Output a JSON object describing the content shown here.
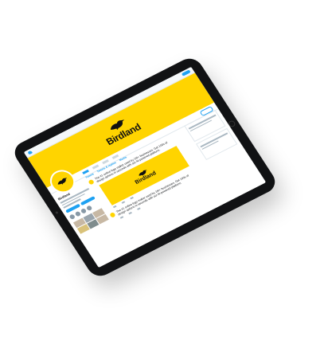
{
  "brand": {
    "name": "Birdland"
  },
  "profile": {
    "name": "Birdland"
  },
  "timeline": {
    "tabs": [
      "Tweets",
      "Tweets & replies",
      "Media"
    ]
  },
  "tweets": [
    {
      "text": "The #1 online logo maker used by 1M+ businesses. Get 100s of design options in seconds with our AI-powered platform.",
      "card_label": "Birdland"
    },
    {
      "text": "The #1 online logo maker used by 1M+ businesses. Get 100s of design options in seconds with our AI-powered platform."
    }
  ],
  "colors": {
    "brand_yellow": "#ffd400",
    "accent_blue": "#1da1f2",
    "device_bezel": "#111214",
    "ink": "#111111"
  },
  "icons": {
    "brand": "bird-silhouette-icon",
    "app": "twitter-bird-icon"
  }
}
